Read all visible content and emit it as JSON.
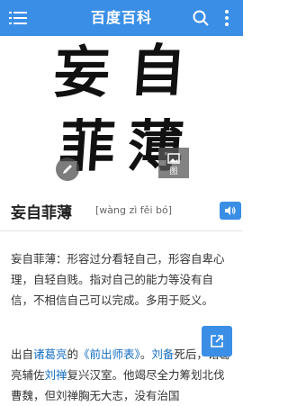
{
  "colors": {
    "brand": "#3a8ee6",
    "link": "#136ec2"
  },
  "header": {
    "title": "百度百科",
    "menu_icon": "hamburger-menu-icon",
    "search_icon": "search-icon",
    "more_icon": "vertical-dots-icon"
  },
  "hero": {
    "calligraphy": [
      "妄",
      "自",
      "菲",
      "薄"
    ],
    "edit_icon": "pencil-icon",
    "image_badge_label": "图",
    "image_badge_icon": "image-icon"
  },
  "entry": {
    "term": "妄自菲薄",
    "pinyin": "[wàng zì fěi bó]",
    "audio_icon": "speaker-icon"
  },
  "definition": {
    "text": "妄自菲薄：形容过分看轻自己，形容自卑心理，自轻自贱。指对自己的能力等没有自信，不相信自己可以完成。多用于贬义。"
  },
  "source": {
    "t1": "出自",
    "l1": "诸葛亮",
    "t2": "的",
    "l2": "《前出师表》",
    "t3": "。",
    "l3": "刘备",
    "t4": "死后，诸葛亮辅佐",
    "l4": "刘禅",
    "t5": "复兴汉室。他竭尽全力筹划北伐曹魏，但刘禅胸无大志，没有治国"
  },
  "share_icon": "share-external-icon"
}
